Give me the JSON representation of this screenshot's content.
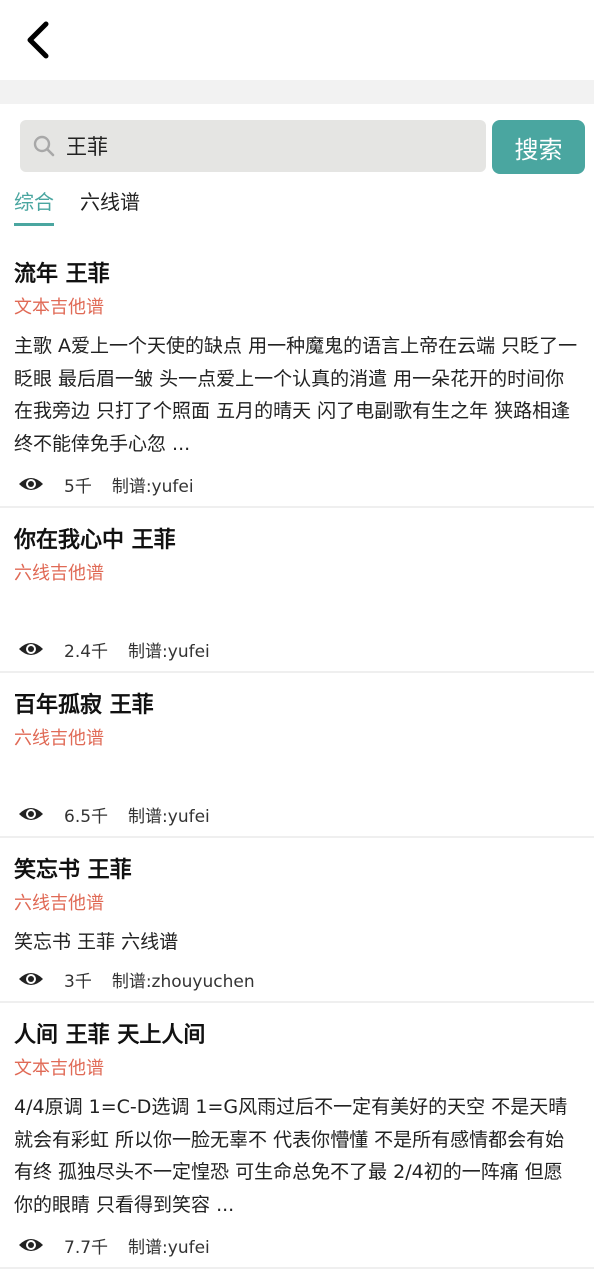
{
  "search": {
    "query": "王菲",
    "button_label": "搜索"
  },
  "tabs": [
    {
      "label": "综合",
      "active": true
    },
    {
      "label": "六线谱",
      "active": false
    }
  ],
  "results": [
    {
      "title": "流年 王菲",
      "type": "文本吉他谱",
      "desc": "主歌 A爱上一个天使的缺点 用一种魔鬼的语言上帝在云端 只眨了一眨眼    最后眉一皱 头一点爱上一个认真的消遣 用一朵花开的时间你在我旁边 只打了个照面    五月的晴天 闪了电副歌有生之年 狭路相逢 终不能倖免手心忽 ...",
      "views": "5千",
      "author": "制谱:yufei"
    },
    {
      "title": "你在我心中 王菲",
      "type": "六线吉他谱",
      "desc": "",
      "views": "2.4千",
      "author": "制谱:yufei"
    },
    {
      "title": "百年孤寂 王菲",
      "type": "六线吉他谱",
      "desc": "",
      "views": "6.5千",
      "author": "制谱:yufei"
    },
    {
      "title": "笑忘书 王菲",
      "type": "六线吉他谱",
      "desc": "笑忘书 王菲 六线谱",
      "views": "3千",
      "author": "制谱:zhouyuchen"
    },
    {
      "title": "人间 王菲 天上人间",
      "type": "文本吉他谱",
      "desc": "4/4原调 1=C-D选调 1=G风雨过后不一定有美好的天空 不是天晴就会有彩虹 所以你一脸无辜不  代表你懵懂 不是所有感情都会有始有终 孤独尽头不一定惶恐 可生命总免不了最  2/4初的一阵痛 但愿你的眼睛 只看得到笑容    ...",
      "views": "7.7千",
      "author": "制谱:yufei"
    }
  ],
  "colors": {
    "accent": "#4aa6a0",
    "type_label": "#e06a56"
  }
}
